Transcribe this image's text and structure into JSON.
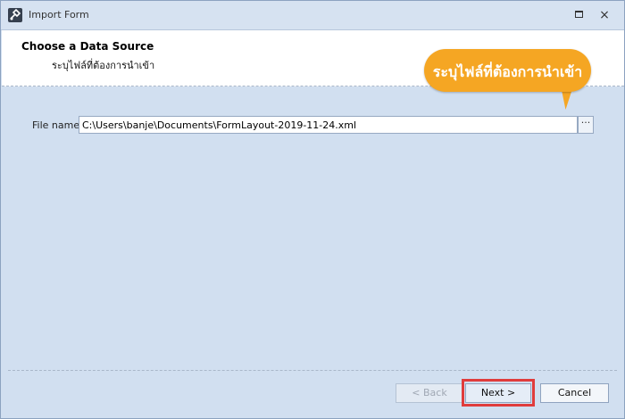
{
  "window": {
    "title": "Import Form",
    "restore_glyph": "restore-icon",
    "close_glyph": "×"
  },
  "header": {
    "title": "Choose a Data Source",
    "subtitle": "ระบุไฟล์ที่ต้องการนำเข้า"
  },
  "callout": {
    "text": "ระบุไฟล์ที่ต้องการนำเข้า",
    "color": "#f5a623"
  },
  "form": {
    "file_label": "File name",
    "file_value": "C:\\Users\\banje\\Documents\\FormLayout-2019-11-24.xml",
    "browse_label": "···"
  },
  "buttons": {
    "back": "< Back",
    "next": "Next >",
    "cancel": "Cancel"
  },
  "colors": {
    "highlight": "#e03c3c",
    "background": "#d1dff0"
  }
}
